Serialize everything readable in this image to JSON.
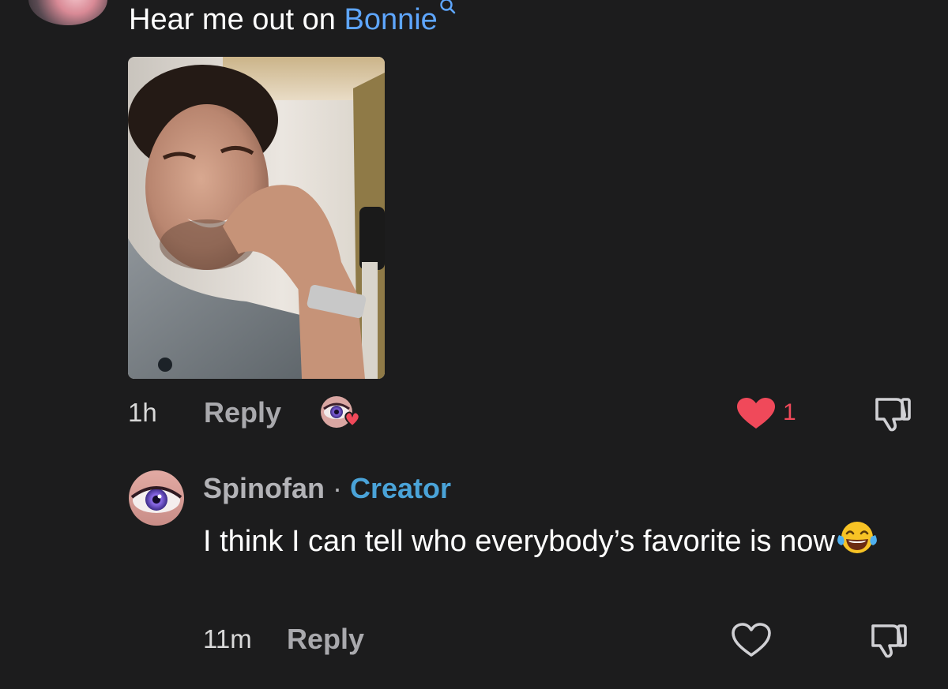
{
  "top_comment": {
    "text_prefix": "Hear me out on ",
    "mention": "Bonnie",
    "time": "1h",
    "reply_label": "Reply",
    "like_count": "1",
    "liked": true,
    "creator_liked": true
  },
  "reply": {
    "author": "Spinofan",
    "separator": " · ",
    "badge": "Creator",
    "text": "I think I can tell who everybody’s favorite is now",
    "emoji": "face-with-tears-of-joy-icon",
    "time": "11m",
    "reply_label": "Reply",
    "liked": false
  },
  "colors": {
    "background": "#1c1c1d",
    "mention": "#5ea6ff",
    "creator_badge": "#4aa3d8",
    "like_red": "#f0495a",
    "muted": "#a9a9ad"
  }
}
